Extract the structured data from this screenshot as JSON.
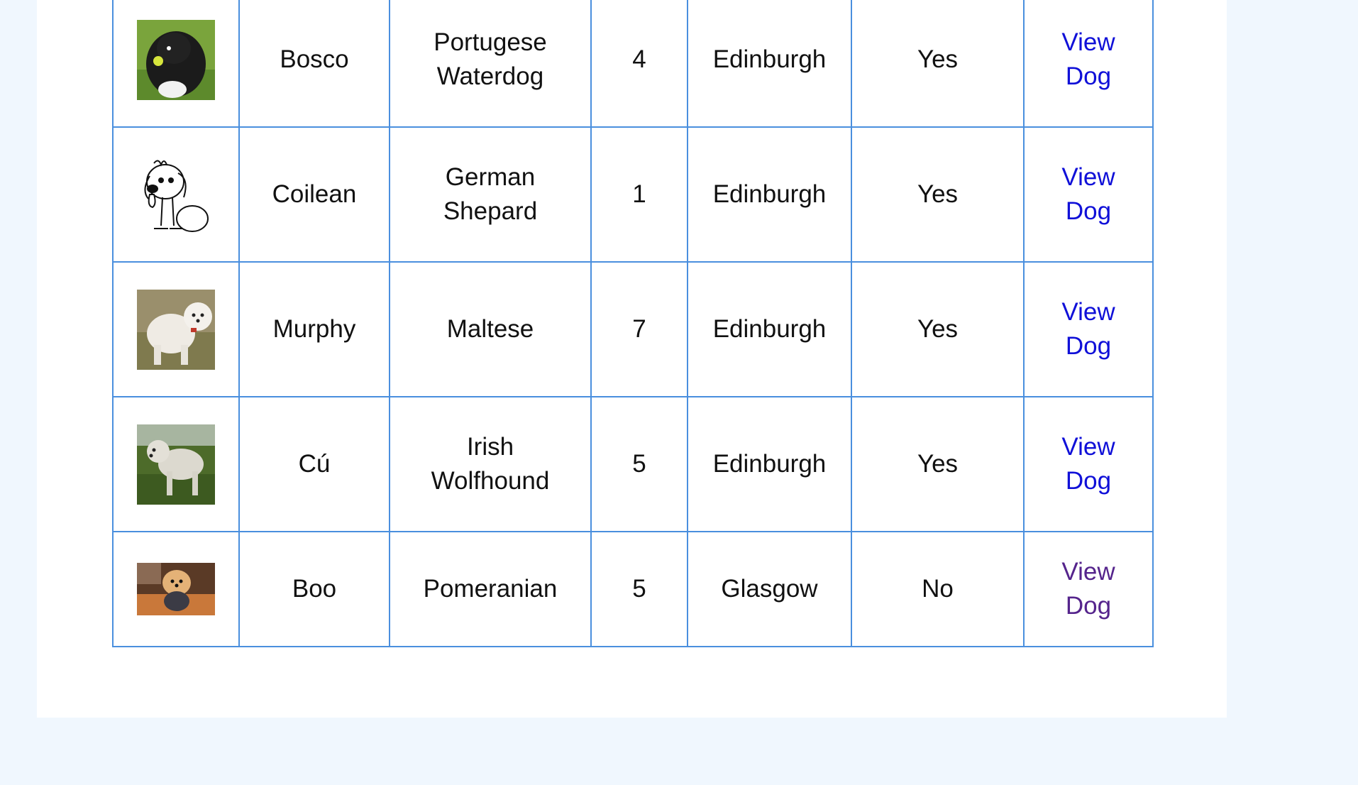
{
  "table": {
    "rows": [
      {
        "name": "Bosco",
        "breed_line1": "Portugese",
        "breed_line2": "Waterdog",
        "age": "4",
        "location": "Edinburgh",
        "available": "Yes",
        "link_line1": "View",
        "link_line2": "Dog",
        "photo": "black-curly-dog-photo"
      },
      {
        "name": "Coilean",
        "breed_line1": "German",
        "breed_line2": "Shepard",
        "age": "1",
        "location": "Edinburgh",
        "available": "Yes",
        "link_line1": "View",
        "link_line2": "Dog",
        "photo": "cartoon-dog-drawing"
      },
      {
        "name": "Murphy",
        "breed_line1": "Maltese",
        "breed_line2": "",
        "age": "7",
        "location": "Edinburgh",
        "available": "Yes",
        "link_line1": "View",
        "link_line2": "Dog",
        "photo": "white-fluffy-dog-photo"
      },
      {
        "name": "Cú",
        "breed_line1": "Irish",
        "breed_line2": "Wolfhound",
        "age": "5",
        "location": "Edinburgh",
        "available": "Yes",
        "link_line1": "View",
        "link_line2": "Dog",
        "photo": "grey-dog-on-grass-photo"
      },
      {
        "name": "Boo",
        "breed_line1": "Pomeranian",
        "breed_line2": "",
        "age": "5",
        "location": "Glasgow",
        "available": "No",
        "link_line1": "View",
        "link_line2": "Dog",
        "photo": "pomeranian-photo"
      }
    ]
  },
  "colors": {
    "page_background": "#f0f7fe",
    "panel_background": "#ffffff",
    "table_border": "#4a8fde",
    "link": "#1010d8",
    "visited_link": "#55248c"
  }
}
